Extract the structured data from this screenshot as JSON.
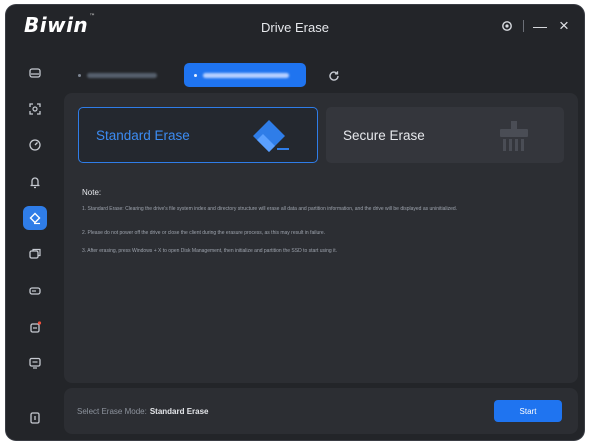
{
  "app": {
    "logo": "Biwin",
    "trademark": "™",
    "title": "Drive Erase"
  },
  "window_controls": {
    "settings_icon": "gear-icon",
    "minimize": "—",
    "close": "×"
  },
  "sidebar": {
    "items": [
      {
        "name": "sidebar-item-drive",
        "icon": "drive-icon",
        "active": false
      },
      {
        "name": "sidebar-item-scan",
        "icon": "scan-icon",
        "active": false
      },
      {
        "name": "sidebar-item-speed",
        "icon": "gauge-icon",
        "active": false
      },
      {
        "name": "sidebar-item-health",
        "icon": "alert-icon",
        "active": false
      },
      {
        "name": "sidebar-item-erase",
        "icon": "eraser-icon",
        "active": true
      },
      {
        "name": "sidebar-item-clone",
        "icon": "clone-icon",
        "active": false
      },
      {
        "name": "sidebar-item-firmware",
        "icon": "firmware-icon",
        "active": false
      },
      {
        "name": "sidebar-item-update",
        "icon": "update-icon",
        "active": false
      },
      {
        "name": "sidebar-item-feedback",
        "icon": "message-icon",
        "active": false
      },
      {
        "name": "sidebar-item-exit",
        "icon": "exit-icon",
        "active": false
      }
    ]
  },
  "devices": {
    "tabs": [
      {
        "active": false
      },
      {
        "active": true
      }
    ],
    "refresh_icon": "refresh-icon"
  },
  "erase_modes": {
    "standard": {
      "label": "Standard Erase",
      "icon": "eraser-icon",
      "selected": true
    },
    "secure": {
      "label": "Secure Erase",
      "icon": "shredder-icon",
      "selected": false
    }
  },
  "note": {
    "title": "Note:",
    "lines": [
      "1. Standard Erase: Clearing the drive's file system index and directory structure will erase all data and partition information, and the drive will be displayed as uninitialized.",
      "2. Please do not power off the drive or close the client during the erasure process, as this may result in failure.",
      "3. After erasing, press Windows + X to open Disk Management, then initialize and partition the SSD to start using it."
    ]
  },
  "footer": {
    "mode_label": "Select Erase Mode:",
    "mode_value": "Standard Erase",
    "start_label": "Start"
  },
  "colors": {
    "accent": "#1f74f0",
    "window_bg": "#232529",
    "panel_bg": "#2c2e33"
  }
}
